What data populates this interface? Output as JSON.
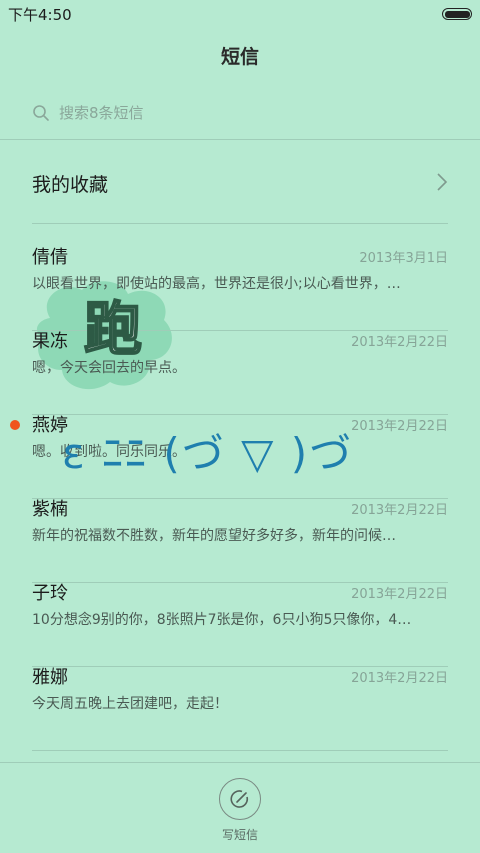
{
  "status": {
    "time": "下午4:50"
  },
  "header": {
    "title": "短信"
  },
  "search": {
    "placeholder": "搜索8条短信"
  },
  "favorites": {
    "label": "我的收藏"
  },
  "threads": [
    {
      "name": "倩倩",
      "date": "2013年3月1日",
      "snippet": "以眼看世界，即使站的最高，世界还是很小;以心看世界，…",
      "unread": false
    },
    {
      "name": "果冻",
      "date": "2013年2月22日",
      "snippet": "嗯，今天会回去的早点。",
      "unread": false
    },
    {
      "name": "燕婷",
      "date": "2013年2月22日",
      "snippet": "嗯。收到啦。同乐同乐。",
      "unread": true
    },
    {
      "name": "紫楠",
      "date": "2013年2月22日",
      "snippet": "新年的祝福数不胜数，新年的愿望好多好多，新年的问候…",
      "unread": false
    },
    {
      "name": "子玲",
      "date": "2013年2月22日",
      "snippet": "10分想念9别的你，8张照片7张是你，6只小狗5只像你，4…",
      "unread": false
    },
    {
      "name": "雅娜",
      "date": "2013年2月22日",
      "snippet": "今天周五晚上去团建吧，走起！",
      "unread": false
    }
  ],
  "compose": {
    "label": "写短信"
  },
  "overlay": {
    "blob_text": "跑",
    "kaomoji": "ε ﾆﾆ (づ ▽ )づ"
  },
  "colors": {
    "background": "#b6ead1",
    "unread_dot": "#f0541d",
    "overlay_blue": "#1f7fae",
    "blob": "#8ed9b6"
  }
}
